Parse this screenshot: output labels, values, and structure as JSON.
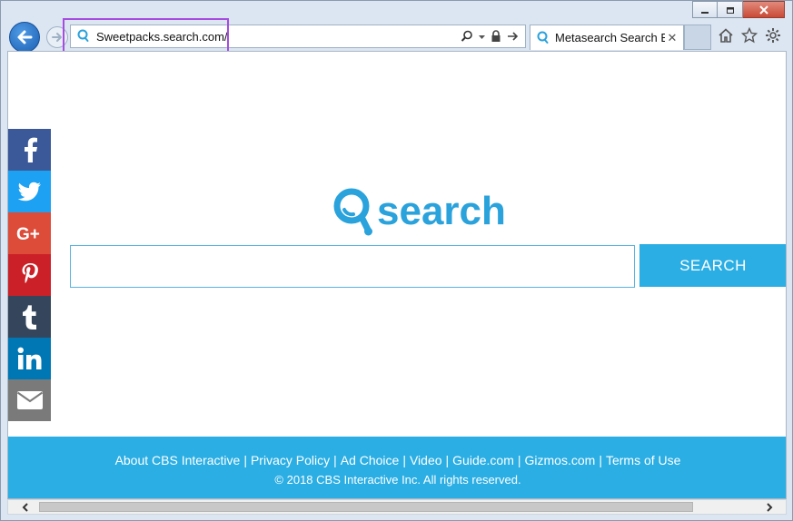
{
  "browser": {
    "address": {
      "url": "Sweetpacks.search.com/"
    },
    "tab": {
      "label": "Metasearch Search En...",
      "close": "✕"
    },
    "icons": {
      "back": "back-arrow-icon",
      "forward": "forward-arrow-icon",
      "search": "magnifier-icon",
      "lock": "lock-icon",
      "refresh": "go-arrow-icon",
      "home": "home-icon",
      "favorites": "star-icon",
      "tools": "gear-icon"
    }
  },
  "page": {
    "logo_text": "search",
    "search_button": "SEARCH",
    "share_buttons": [
      {
        "name": "facebook",
        "color": "#3b5998",
        "glyph": "f"
      },
      {
        "name": "twitter",
        "color": "#1da1f2",
        "glyph": "twitter"
      },
      {
        "name": "google-plus",
        "color": "#dd4b39",
        "glyph": "G+"
      },
      {
        "name": "pinterest",
        "color": "#cb2027",
        "glyph": "P"
      },
      {
        "name": "tumblr",
        "color": "#35465c",
        "glyph": "t"
      },
      {
        "name": "linkedin",
        "color": "#0077b5",
        "glyph": "in"
      },
      {
        "name": "email",
        "color": "#7a7a7a",
        "glyph": "envelope"
      }
    ],
    "footer": {
      "links": [
        "About CBS Interactive",
        "Privacy Policy",
        "Ad Choice",
        "Video",
        "Guide.com",
        "Gizmos.com",
        "Terms of Use"
      ],
      "separator": "|",
      "copyright": "© 2018 CBS Interactive Inc. All rights reserved."
    }
  },
  "colors": {
    "accent": "#2aaee4",
    "highlight": "#a64ce0"
  }
}
